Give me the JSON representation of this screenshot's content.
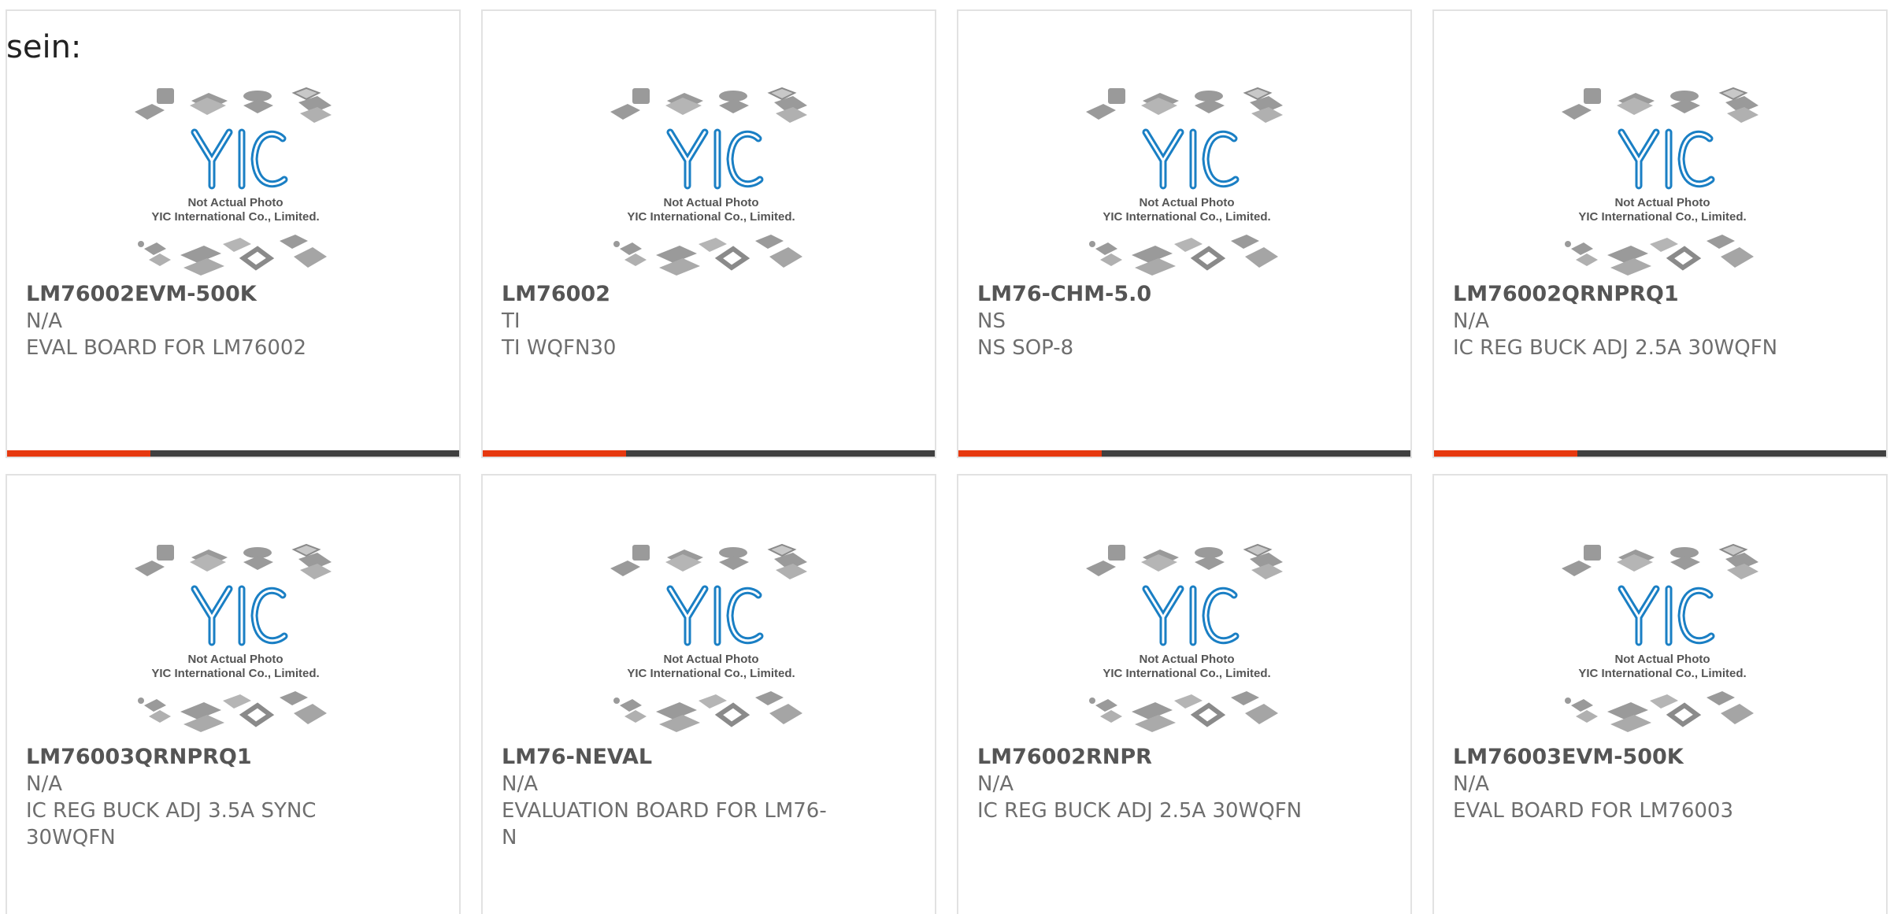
{
  "page": {
    "lead_text": "sein:"
  },
  "photo": {
    "logo_text": "YIC",
    "caption_line1": "Not Actual Photo",
    "caption_line2": "YIC International Co., Limited."
  },
  "colors": {
    "accent": "#e6380f",
    "bar": "#404040",
    "logo_blue": "#1a7fc4"
  },
  "products": [
    {
      "part": "LM76002EVM-500K",
      "manufacturer": "N/A",
      "description": "EVAL BOARD FOR LM76002"
    },
    {
      "part": "LM76002",
      "manufacturer": "TI",
      "description": "TI WQFN30"
    },
    {
      "part": "LM76-CHM-5.0",
      "manufacturer": "NS",
      "description": "NS SOP-8"
    },
    {
      "part": "LM76002QRNPRQ1",
      "manufacturer": "N/A",
      "description": "IC REG BUCK ADJ 2.5A 30WQFN"
    },
    {
      "part": "LM76003QRNPRQ1",
      "manufacturer": "N/A",
      "description": "IC REG BUCK ADJ 3.5A SYNC 30WQFN"
    },
    {
      "part": "LM76-NEVAL",
      "manufacturer": "N/A",
      "description": "EVALUATION BOARD FOR LM76-N"
    },
    {
      "part": "LM76002RNPR",
      "manufacturer": "N/A",
      "description": "IC REG BUCK ADJ 2.5A 30WQFN"
    },
    {
      "part": "LM76003EVM-500K",
      "manufacturer": "N/A",
      "description": "EVAL BOARD FOR LM76003"
    }
  ]
}
